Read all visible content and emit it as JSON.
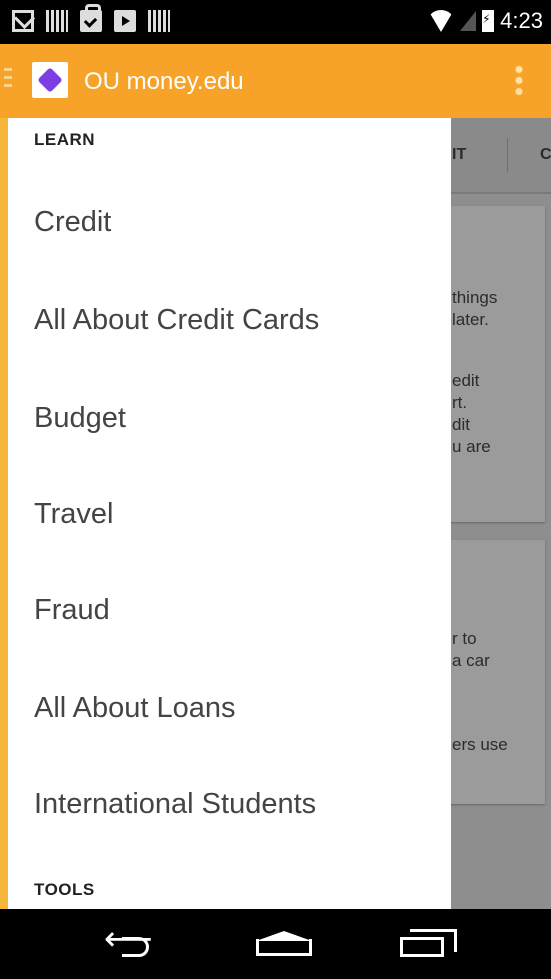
{
  "status_bar": {
    "time": "4:23"
  },
  "action_bar": {
    "title": "OU money.edu"
  },
  "background": {
    "tab_fragments": [
      "IT",
      "C"
    ],
    "card1_fragments": [
      "things",
      "later.",
      "edit",
      "rt.",
      "dit",
      "u are"
    ],
    "card2_fragments": [
      "r to",
      "a car",
      "ers use"
    ]
  },
  "drawer": {
    "learn_header": "LEARN",
    "items": [
      {
        "label": "Credit"
      },
      {
        "label": "All About Credit Cards"
      },
      {
        "label": "Budget"
      },
      {
        "label": "Travel"
      },
      {
        "label": "Fraud"
      },
      {
        "label": "All About Loans"
      },
      {
        "label": "International Students"
      }
    ],
    "tools_header": "TOOLS"
  }
}
